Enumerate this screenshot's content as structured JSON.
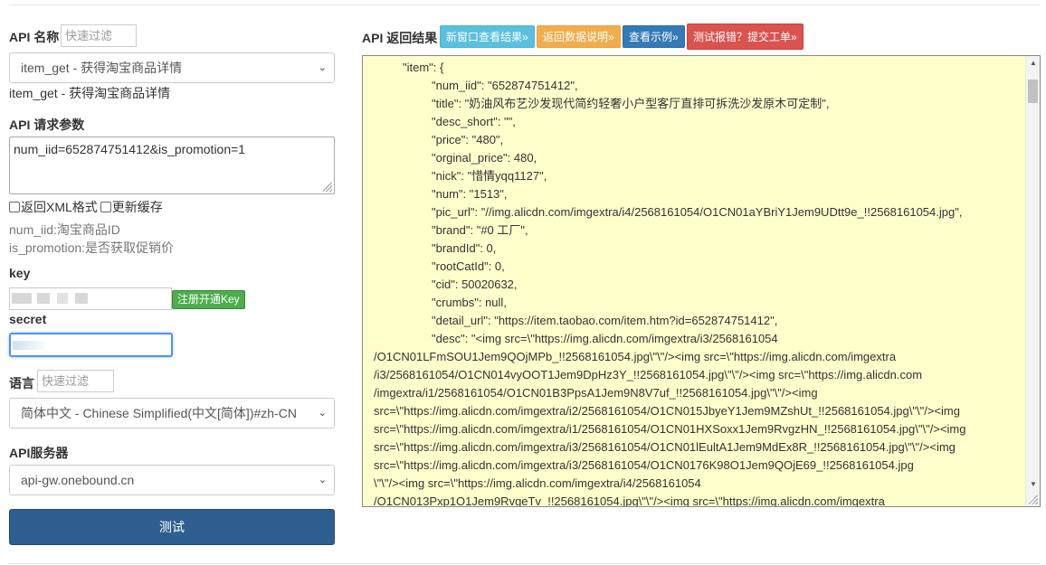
{
  "left": {
    "api_name_label": "API 名称",
    "api_filter_placeholder": "快速过滤",
    "api_select_value": "item_get - 获得淘宝商品详情",
    "api_description": "item_get - 获得淘宝商品详情",
    "params_label": "API 请求参数",
    "params_value": "num_iid=652874751412&is_promotion=1",
    "xml_checkbox_label": "返回XML格式",
    "cache_checkbox_label": "更新缓存",
    "param_notes": [
      "num_iid:淘宝商品ID",
      "is_promotion:是否获取促销价"
    ],
    "key_label": "key",
    "register_key_button": "注册开通Key",
    "secret_label": "secret",
    "language_label": "语言",
    "language_filter_placeholder": "快速过滤",
    "language_select_value": "简体中文 - Chinese Simplified(中文[简体])#zh-CN",
    "server_label": "API服务器",
    "server_select_value": "api-gw.onebound.cn",
    "test_button": "测试"
  },
  "right": {
    "result_label": "API 返回结果",
    "buttons": [
      {
        "label": "新窗口查看结果»",
        "color": "#5bc0de"
      },
      {
        "label": "返回数据说明»",
        "color": "#f0ad4e"
      },
      {
        "label": "查看示例»",
        "color": "#337ab7"
      },
      {
        "label": "测试报错？提交工单»",
        "color": "#d9534f"
      }
    ],
    "result_lines": [
      "\"item\": {",
      "\"num_iid\": \"652874751412\",",
      "\"title\": \"奶油风布艺沙发现代简约轻奢小户型客厅直排可拆洗沙发原木可定制\",",
      "\"desc_short\": \"\",",
      "\"price\": \"480\",",
      "\"orginal_price\": 480,",
      "\"nick\": \"惜情yqq1127\",",
      "\"num\": \"1513\",",
      "\"pic_url\": \"//img.alicdn.com/imgextra/i4/2568161054/O1CN01aYBriY1Jem9UDtt9e_!!2568161054.jpg\",",
      "\"brand\": \"#0 工厂\",",
      "\"brandId\": 0,",
      "\"rootCatId\": 0,",
      "\"cid\": 50020632,",
      "\"crumbs\": null,",
      "\"detail_url\": \"https://item.taobao.com/item.htm?id=652874751412\",",
      "\"desc\": \"<img src=\\\"https://img.alicdn.com/imgextra/i3/2568161054",
      "/O1CN01LFmSOU1Jem9QOjMPb_!!2568161054.jpg\\\"\\\"/><img src=\\\"https://img.alicdn.com/imgextra",
      "/i3/2568161054/O1CN014vyOOT1Jem9DpHz3Y_!!2568161054.jpg\\\"\\\"/><img src=\\\"https://img.alicdn.com",
      "/imgextra/i1/2568161054/O1CN01B3PpsA1Jem9N8V7uf_!!2568161054.jpg\\\"\\\"/><img",
      "src=\\\"https://img.alicdn.com/imgextra/i2/2568161054/O1CN015JbyeY1Jem9MZshUt_!!2568161054.jpg\\\"\\\"/><img",
      "src=\\\"https://img.alicdn.com/imgextra/i1/2568161054/O1CN01HXSoxx1Jem9RvgzHN_!!2568161054.jpg\\\"\\\"/><img",
      "src=\\\"https://img.alicdn.com/imgextra/i3/2568161054/O1CN01lEultA1Jem9MdEx8R_!!2568161054.jpg\\\"\\\"/><img",
      "src=\\\"https://img.alicdn.com/imgextra/i3/2568161054/O1CN0176K98O1Jem9QOjE69_!!2568161054.jpg",
      "\\\"\\\"/><img src=\\\"https://img.alicdn.com/imgextra/i4/2568161054",
      "/O1CN013Pxp1O1Jem9RvgeTv_!!2568161054.jpg\\\"\\\"/><img src=\\\"https://img.alicdn.com/imgextra"
    ]
  },
  "colors": {
    "result_background": "#ffffcc",
    "test_button": "#2f5f91",
    "register_button": "#4cae4c",
    "focus_border": "#4d90fe"
  }
}
